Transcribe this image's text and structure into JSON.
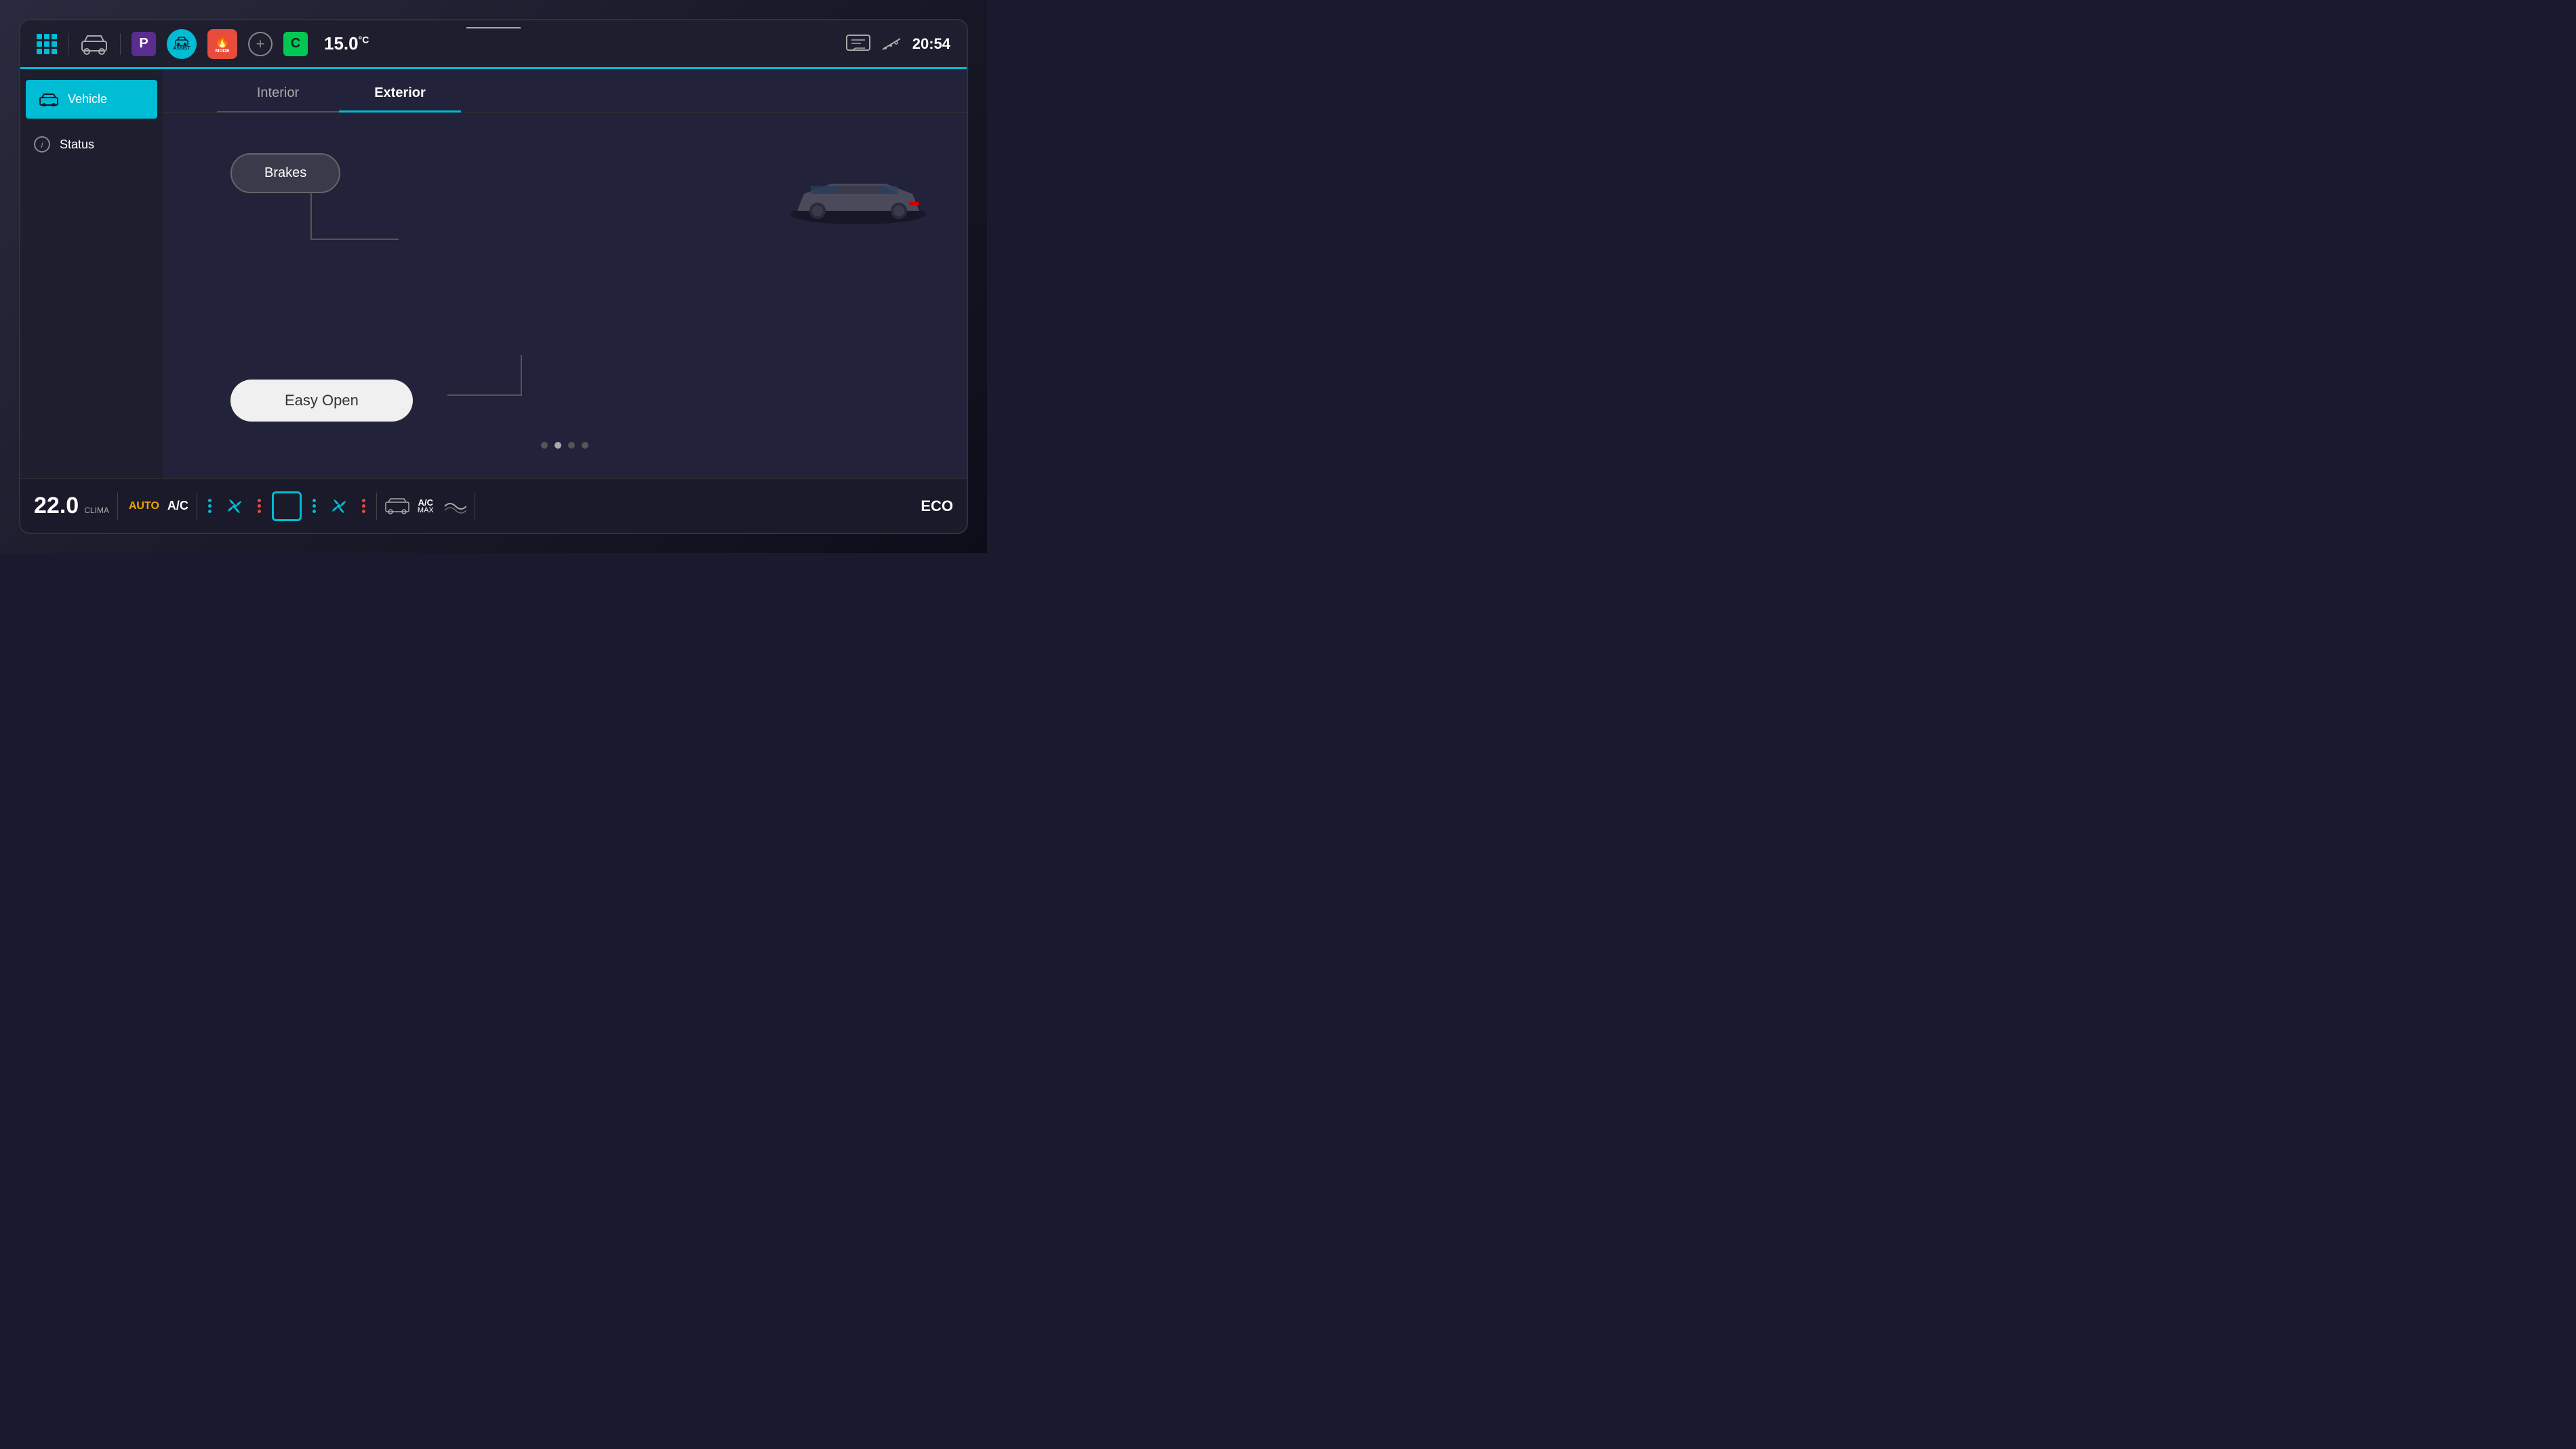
{
  "screen": {
    "topBar": {
      "temperature": "15.0",
      "tempUnit": "°C",
      "time": "20:54",
      "parkingLabel": "P",
      "assistLabel": "ASSIST",
      "modeLabel": "MODE",
      "cLabel": "C"
    },
    "sidebar": {
      "items": [
        {
          "id": "vehicle",
          "label": "Vehicle",
          "active": true
        },
        {
          "id": "status",
          "label": "Status",
          "active": false
        }
      ]
    },
    "tabs": [
      {
        "id": "interior",
        "label": "Interior",
        "active": false
      },
      {
        "id": "exterior",
        "label": "Exterior",
        "active": true
      }
    ],
    "content": {
      "brakesButton": "Brakes",
      "easyOpenButton": "Easy Open",
      "paginationDots": 4,
      "activeDot": 2
    },
    "bottomBar": {
      "temp": "22.0",
      "climaLabel": "CLIMA",
      "autoLabel": "AUTO",
      "acLabel": "A/C",
      "ecoLabel": "ECO",
      "acMaxLabel": "A/C\nMAX",
      "underlineDecor": "—"
    }
  }
}
